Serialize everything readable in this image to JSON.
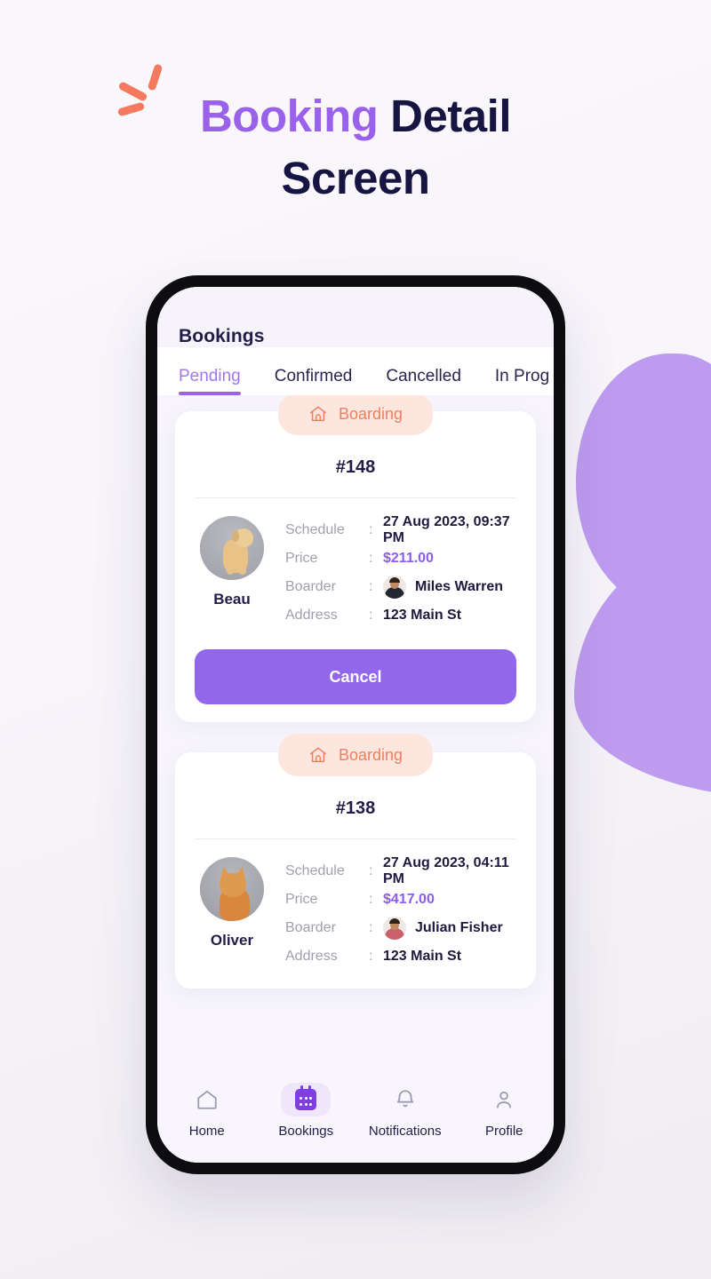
{
  "page": {
    "title_accent": "Booking",
    "title_rest": " Detail",
    "title_line2": "Screen",
    "accent_purple": "#9a62ea",
    "title_dark": "#161440",
    "sparkle_color": "#f4795e",
    "blob_color": "#bd9bef",
    "background": "#f7f5fa"
  },
  "app": {
    "header_title": "Bookings",
    "tabs": [
      {
        "label": "Pending",
        "active": true
      },
      {
        "label": "Confirmed",
        "active": false
      },
      {
        "label": "Cancelled",
        "active": false
      },
      {
        "label": "In Prog",
        "active": false
      }
    ],
    "labels": {
      "schedule": "Schedule",
      "price": "Price",
      "boarder": "Boarder",
      "address": "Address",
      "colon": ":"
    },
    "bookings": [
      {
        "badge": "Boarding",
        "badge_icon": "dog-house-icon",
        "id": "#148",
        "pet_name": "Beau",
        "pet_type": "dog",
        "schedule": "27 Aug 2023, 09:37 PM",
        "price": "$211.00",
        "boarder": "Miles Warren",
        "address": "123 Main St",
        "action_label": "Cancel"
      },
      {
        "badge": "Boarding",
        "badge_icon": "dog-house-icon",
        "id": "#138",
        "pet_name": "Oliver",
        "pet_type": "cat",
        "schedule": "27 Aug 2023, 04:11 PM",
        "price": "$417.00",
        "boarder": "Julian Fisher",
        "address": "123 Main St",
        "action_label": ""
      }
    ],
    "bottom_nav": [
      {
        "label": "Home",
        "icon": "home-icon",
        "active": false
      },
      {
        "label": "Bookings",
        "icon": "calendar-icon",
        "active": true
      },
      {
        "label": "Notifications",
        "icon": "bell-icon",
        "active": false
      },
      {
        "label": "Profile",
        "icon": "person-icon",
        "active": false
      }
    ]
  }
}
